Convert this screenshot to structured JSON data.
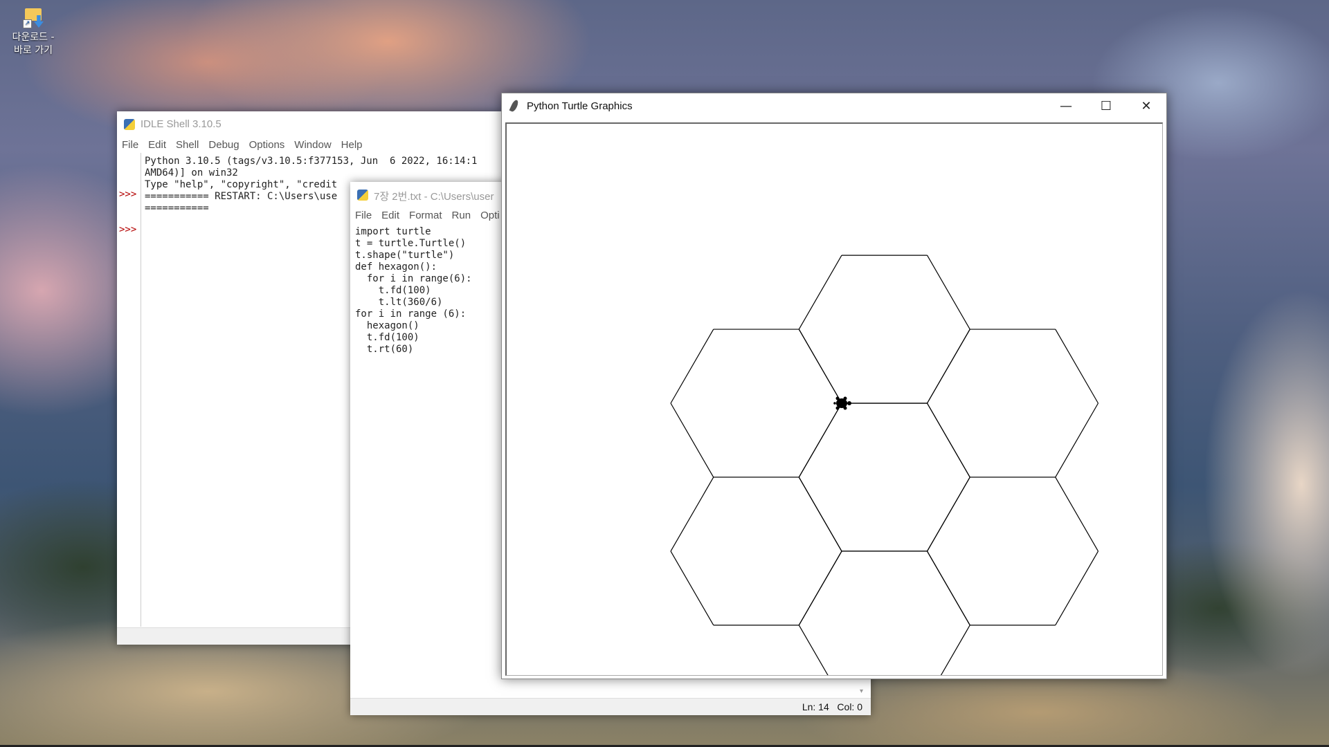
{
  "desktop": {
    "shortcut_label": "다운로드 -\n바로 가기"
  },
  "idle_shell": {
    "title": "IDLE Shell 3.10.5",
    "menu": [
      "File",
      "Edit",
      "Shell",
      "Debug",
      "Options",
      "Window",
      "Help"
    ],
    "prompts": [
      ">>>",
      ">>>"
    ],
    "lines": [
      "Python 3.10.5 (tags/v3.10.5:f377153, Jun  6 2022, 16:14:1",
      "AMD64)] on win32",
      "Type \"help\", \"copyright\", \"credit",
      "",
      "=========== RESTART: C:\\Users\\use",
      "==========="
    ]
  },
  "editor": {
    "title": "7장 2번.txt - C:\\Users\\user",
    "menu": [
      "File",
      "Edit",
      "Format",
      "Run",
      "Opti"
    ],
    "code": [
      "import turtle",
      "t = turtle.Turtle()",
      "t.shape(\"turtle\")",
      "",
      "def hexagon():",
      "  for i in range(6):",
      "    t.fd(100)",
      "    t.lt(360/6)",
      "",
      "for i in range (6):",
      "  hexagon()",
      "  t.fd(100)",
      "  t.rt(60)"
    ],
    "status": "Ln: 14   Col: 0"
  },
  "turtle_window": {
    "title": "Python Turtle Graphics",
    "minimize_glyph": "—",
    "maximize_glyph": "☐",
    "close_glyph": "✕",
    "drawing": {
      "shape": "hexagon",
      "hexagon_count": 6,
      "side_length": 100,
      "turtle_shape": "turtle",
      "line_color": "#000000"
    }
  }
}
